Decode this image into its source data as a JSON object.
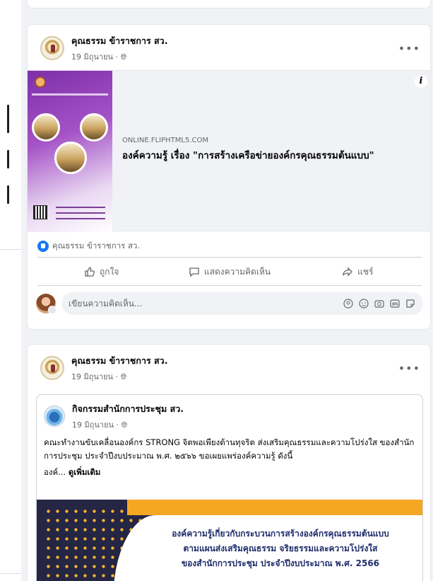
{
  "post1": {
    "author": "คุณธรรม ข้าราชการ สว.",
    "date": "19 มิถุนายน",
    "more_label": "•••",
    "link": {
      "domain": "ONLINE.FLIPHTML5.COM",
      "title": "องค์ความรู้ เรื่อง \"การสร้างเครือข่ายองค์กรคุณธรรมต้นแบบ\"",
      "info_label": "i"
    },
    "reaction_name": "คุณธรรม ข้าราชการ สว.",
    "actions": {
      "like": "ถูกใจ",
      "comment": "แสดงความคิดเห็น",
      "share": "แชร์"
    },
    "comment_placeholder": "เขียนความคิดเห็น..."
  },
  "post2": {
    "author": "คุณธรรม ข้าราชการ สว.",
    "date": "19 มิถุนายน",
    "more_label": "•••",
    "shared": {
      "author": "กิจกรรมสำนักการประชุม สว.",
      "date": "19 มิถุนายน",
      "body": "คณะทำงานขับเคลื่อนองค์กร STRONG จิตพอเพียงต้านทุจริต ส่งเสริมคุณธรรมและความโปร่งใส ของสำนักการประชุม ประจำปีงบประมาณ พ.ศ. ๒๕๖๖ ขอเผยแพร่องค์ความรู้ ดังนี้",
      "truncated": "องค์...",
      "see_more": "ดูเพิ่มเติม",
      "banner_lines": [
        "องค์ความรู้เกี่ยวกับกระบวนการสร้างองค์กรคุณธรรมต้นแบบ",
        "ตามแผนส่งเสริมคุณธรรม จริยธรรมและความโปร่งใส",
        "ของสำนักการประชุม ประจำปีงบประมาณ พ.ศ. 2566"
      ]
    }
  },
  "colors": {
    "page_bg": "#f0f2f5",
    "card_bg": "#ffffff",
    "link_blue": "#1877f2",
    "banner_navy": "#252544",
    "banner_orange": "#f5a623",
    "banner_text": "#1f2d6b"
  }
}
